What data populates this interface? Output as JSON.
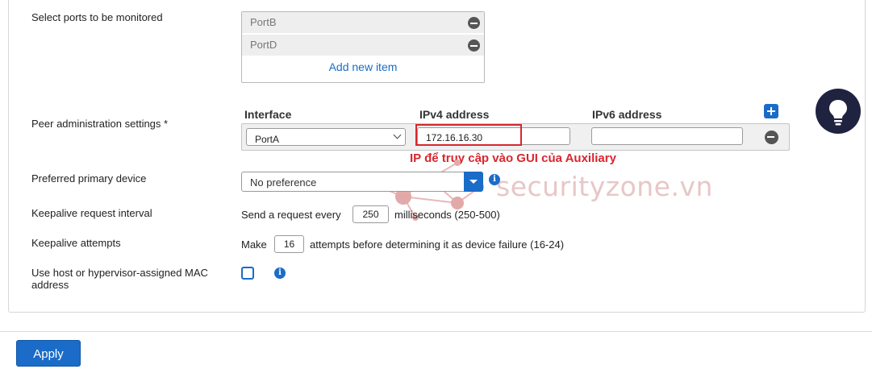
{
  "ports": {
    "label": "Select ports to be monitored",
    "items": [
      "PortB",
      "PortD"
    ],
    "add_label": "Add new item"
  },
  "peer": {
    "label": "Peer administration settings",
    "required_mark": "*",
    "columns": {
      "interface": "Interface",
      "ipv4": "IPv4 address",
      "ipv6": "IPv6 address"
    },
    "row": {
      "interface_value": "PortA",
      "ipv4_value": "172.16.16.30",
      "ipv6_value": ""
    }
  },
  "annotation": "IP để truy cập vào GUI của Auxiliary",
  "preferred": {
    "label": "Preferred primary device",
    "value": "No preference"
  },
  "keepalive_interval": {
    "label": "Keepalive request interval",
    "prefix": "Send a request every",
    "value": "250",
    "suffix": "milliseconds (250-500)"
  },
  "keepalive_attempts": {
    "label": "Keepalive attempts",
    "prefix": "Make",
    "value": "16",
    "suffix": "attempts before determining it as device failure (16-24)"
  },
  "mac": {
    "label": "Use host or hypervisor-assigned MAC address",
    "checked": false
  },
  "footer": {
    "apply_label": "Apply"
  },
  "watermark": "securityzone.vn",
  "colors": {
    "accent": "#1a6cc8",
    "annotation": "#d9262d",
    "assistant_bubble": "#1f2340"
  },
  "icons": {
    "remove": "minus-circle-icon",
    "add": "plus-square-icon",
    "info": "info-icon",
    "assistant": "lightbulb-icon"
  }
}
